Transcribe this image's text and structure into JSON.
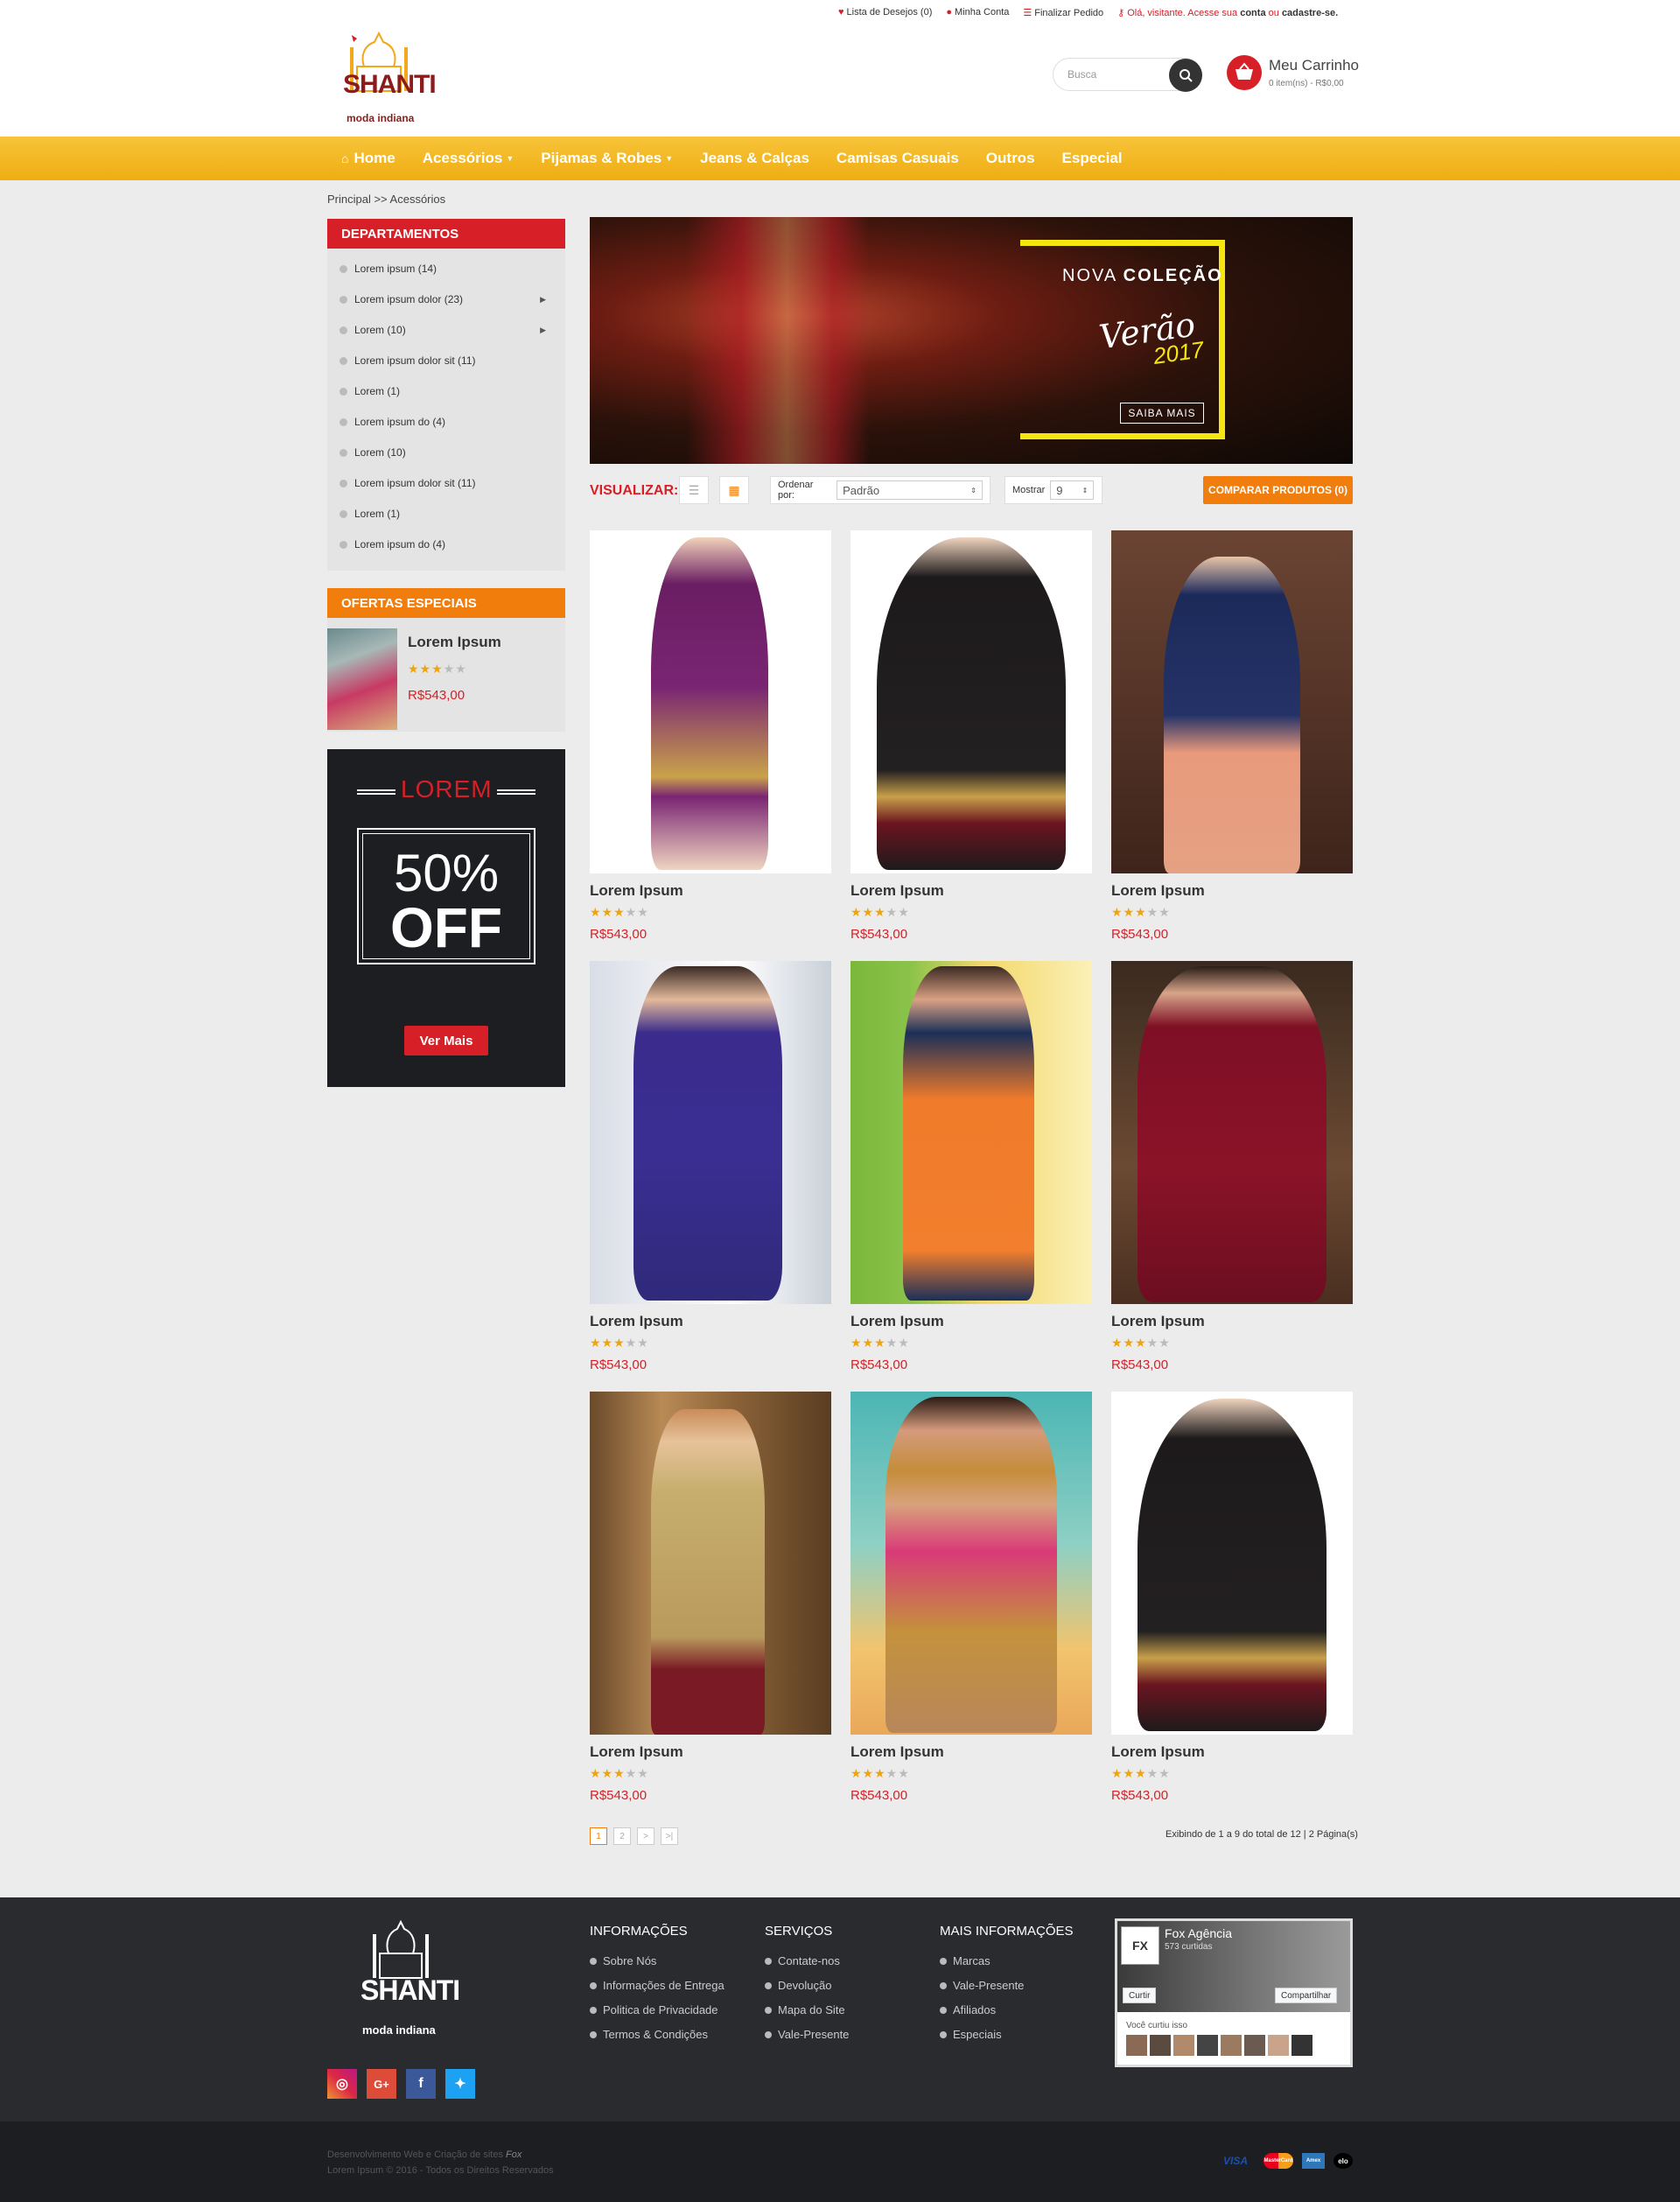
{
  "header": {
    "links": {
      "wishlist": "Lista de Desejos (0)",
      "account": "Minha Conta",
      "checkout": "Finalizar Pedido",
      "greeting_prefix": "Olá, visitante. Acesse sua",
      "greeting_account": "conta",
      "greeting_or": "ou",
      "greeting_register": "cadastre-se."
    },
    "logo": {
      "name": "SHANTI",
      "tagline": "moda indiana"
    },
    "search_placeholder": "Busca",
    "cart": {
      "title": "Meu Carrinho",
      "summary": "0 item(ns) - R$0,00"
    }
  },
  "nav": [
    {
      "label": "Home"
    },
    {
      "label": "Acessórios"
    },
    {
      "label": "Pijamas & Robes"
    },
    {
      "label": "Jeans & Calças"
    },
    {
      "label": "Camisas Casuais"
    },
    {
      "label": "Outros"
    },
    {
      "label": "Especial"
    }
  ],
  "breadcrumb": "Principal >> Acessórios",
  "sidebar": {
    "departments_title": "DEPARTAMENTOS",
    "departments": [
      {
        "label": "Lorem ipsum (14)"
      },
      {
        "label": "Lorem ipsum dolor (23)",
        "arrow": true
      },
      {
        "label": "Lorem (10)",
        "arrow": true
      },
      {
        "label": "Lorem ipsum dolor sit (11)"
      },
      {
        "label": "Lorem (1)"
      },
      {
        "label": "Lorem ipsum do (4)"
      },
      {
        "label": "Lorem (10)"
      },
      {
        "label": "Lorem ipsum dolor sit (11)"
      },
      {
        "label": "Lorem (1)"
      },
      {
        "label": "Lorem ipsum do (4)"
      }
    ],
    "offers_title": "OFERTAS ESPECIAIS",
    "offer": {
      "name": "Lorem Ipsum",
      "rating": 3,
      "price": "R$543,00"
    },
    "promo": {
      "heading": "LOREM",
      "percent": "50%",
      "off": "OFF",
      "button": "Ver Mais"
    }
  },
  "banner": {
    "line1_a": "NOVA",
    "line1_b": "COLEÇÃO",
    "script": "Verão",
    "year": "2017",
    "cta": "SAIBA MAIS"
  },
  "toolbar": {
    "view_label": "VISUALIZAR:",
    "sort_label": "Ordenar por:",
    "sort_value": "Padrão",
    "show_label": "Mostrar",
    "show_value": "9",
    "compare": "COMPARAR PRODUTOS (0)"
  },
  "products": [
    {
      "name": "Lorem Ipsum",
      "rating": 3,
      "price": "R$543,00"
    },
    {
      "name": "Lorem Ipsum",
      "rating": 3,
      "price": "R$543,00"
    },
    {
      "name": "Lorem Ipsum",
      "rating": 3,
      "price": "R$543,00"
    },
    {
      "name": "Lorem Ipsum",
      "rating": 3,
      "price": "R$543,00"
    },
    {
      "name": "Lorem Ipsum",
      "rating": 3,
      "price": "R$543,00"
    },
    {
      "name": "Lorem Ipsum",
      "rating": 3,
      "price": "R$543,00"
    },
    {
      "name": "Lorem Ipsum",
      "rating": 3,
      "price": "R$543,00"
    },
    {
      "name": "Lorem Ipsum",
      "rating": 3,
      "price": "R$543,00"
    },
    {
      "name": "Lorem Ipsum",
      "rating": 3,
      "price": "R$543,00"
    }
  ],
  "pagination": {
    "pages": [
      "1",
      "2",
      ">",
      ">|"
    ],
    "current": "1",
    "summary": "Exibindo de 1 a 9 do total de 12 | 2 Página(s)"
  },
  "footer": {
    "columns": [
      {
        "title": "INFORMAÇÕES",
        "items": [
          "Sobre Nós",
          "Informações de Entrega",
          "Politica de Privacidade",
          "Termos & Condições"
        ]
      },
      {
        "title": "SERVIÇOS",
        "items": [
          "Contate-nos",
          "Devolução",
          "Mapa do Site",
          "Vale-Presente"
        ]
      },
      {
        "title": "MAIS INFORMAÇÕES",
        "items": [
          "Marcas",
          "Vale-Presente",
          "Afiliados",
          "Especiais"
        ]
      }
    ],
    "social": [
      "instagram-icon",
      "google-plus-icon",
      "facebook-icon",
      "twitter-icon"
    ],
    "facebook": {
      "page": "Fox Agência",
      "likes": "573 curtidas",
      "like_btn": "Curtir",
      "share_btn": "Compartilhar",
      "friends": "Você curtiu isso"
    },
    "credit": "Desenvolvimento Web e Criação de sites",
    "credit_brand": "Fox",
    "copyright": "Lorem Ipsum © 2016 - Todos os Direitos Reservados",
    "payments": [
      "VISA",
      "MasterCard",
      "Amex",
      "elo"
    ]
  },
  "colors": {
    "brand_red": "#d61f26",
    "nav_yellow": "#f3b51f",
    "accent_orange": "#f07d0c",
    "footer_dark": "#2a2b2f"
  }
}
